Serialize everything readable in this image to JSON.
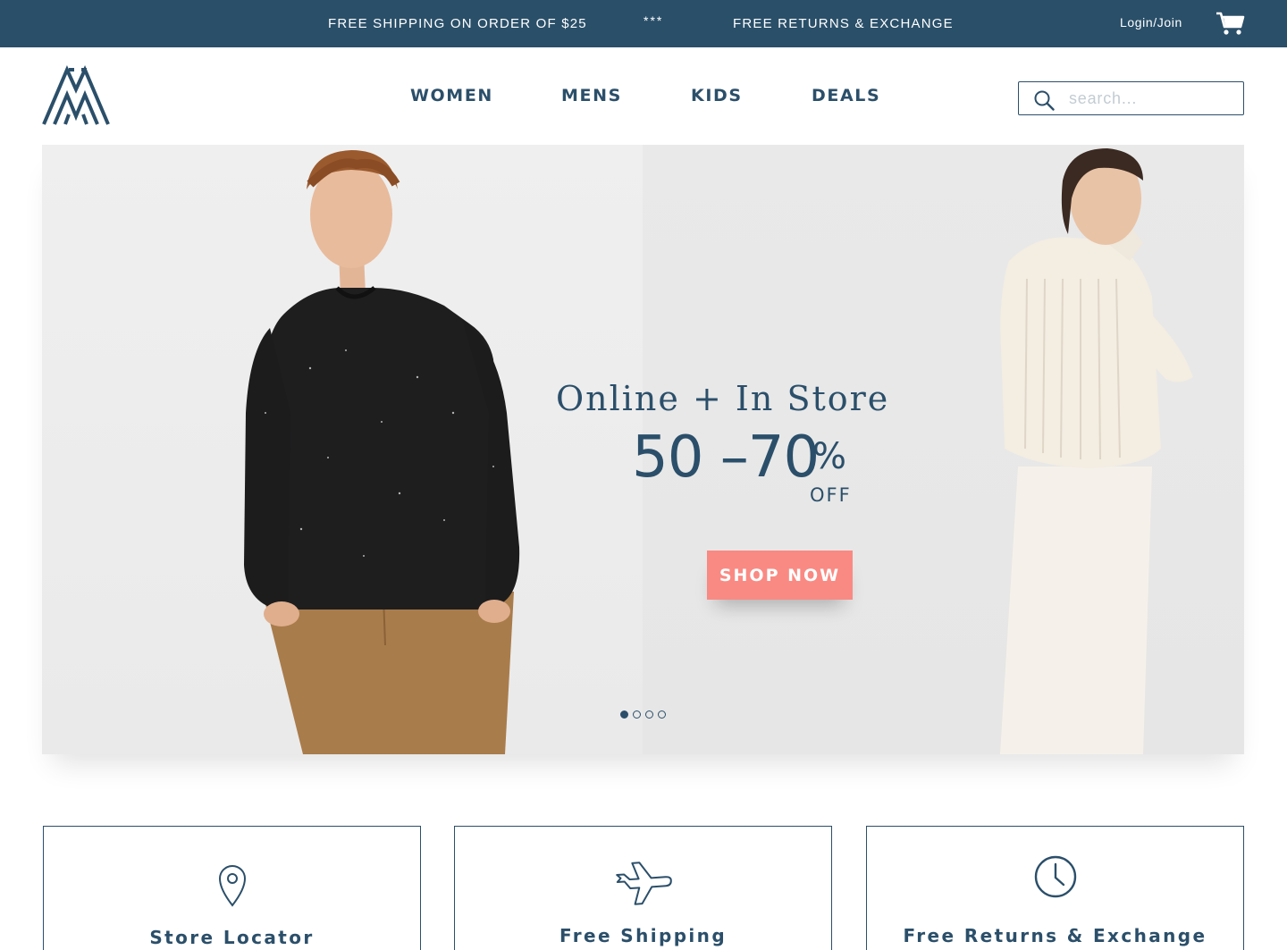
{
  "topbar": {
    "promo_shipping": "FREE SHIPPING ON ORDER OF $25",
    "separator": "***",
    "promo_returns": "FREE RETURNS & EXCHANGE",
    "login_label": "Login/Join",
    "cart_icon": "cart-icon"
  },
  "header": {
    "logo_icon": "brand-logo",
    "nav": [
      "WOMEN",
      "MENS",
      "KIDS",
      "DEALS"
    ],
    "search": {
      "placeholder": "search...",
      "value": "",
      "icon": "search-icon"
    }
  },
  "hero": {
    "headline": "Online + In Store",
    "discount": "50 –70",
    "percent": "%",
    "off": "OFF",
    "cta_label": "SHOP NOW",
    "slides_total": 4,
    "active_slide": 1
  },
  "features": [
    {
      "label": "Store Locator",
      "icon": "location-pin-icon"
    },
    {
      "label": "Free Shipping",
      "icon": "airplane-icon"
    },
    {
      "label": "Free Returns & Exchange",
      "icon": "clock-icon"
    }
  ],
  "colors": {
    "brand_navy": "#2a4f69",
    "cta_coral": "#f98a83",
    "hero_bg": "#ececec"
  }
}
